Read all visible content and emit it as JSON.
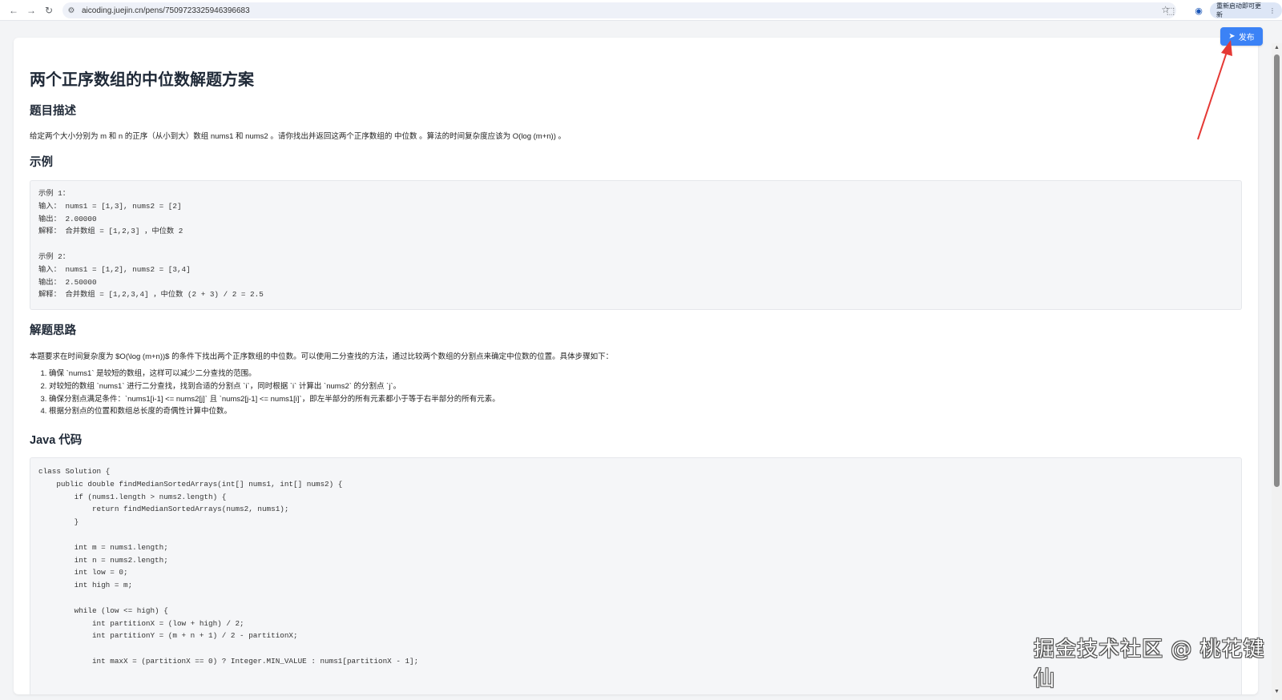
{
  "browser": {
    "url": "aicoding.juejin.cn/pens/7509723325946396683",
    "update_label": "重新启动即可更新",
    "icons": [
      "back-icon",
      "forward-icon",
      "reload-icon",
      "site-info-icon",
      "star-icon",
      "extensions-icon",
      "profile-icon",
      "more-icon"
    ]
  },
  "toolbar": {
    "publish_label": "发布"
  },
  "article": {
    "title": "两个正序数组的中位数解题方案",
    "sections": {
      "description_heading": "题目描述",
      "description_text": "给定两个大小分别为  m  和  n  的正序（从小到大）数组  nums1  和  nums2 。请你找出并返回这两个正序数组的  中位数 。算法的时间复杂度应该为  O(log (m+n)) 。",
      "examples_heading": "示例",
      "examples_code": [
        "示例 1：",
        "输入： nums1 = [1,3], nums2 = [2]",
        "输出： 2.00000",
        "解释： 合并数组 = [1,2,3] ，中位数 2",
        "",
        "示例 2：",
        "输入： nums1 = [1,2], nums2 = [3,4]",
        "输出： 2.50000",
        "解释： 合并数组 = [1,2,3,4] ，中位数 (2 + 3) / 2 = 2.5"
      ],
      "approach_heading": "解题思路",
      "approach_text": "本题要求在时间复杂度为 $O(\\log (m+n))$ 的条件下找出两个正序数组的中位数。可以使用二分查找的方法，通过比较两个数组的分割点来确定中位数的位置。具体步骤如下：",
      "steps": [
        "确保 `nums1` 是较短的数组，这样可以减少二分查找的范围。",
        "对较短的数组 `nums1` 进行二分查找，找到合适的分割点 `i`，同时根据 `i` 计算出 `nums2` 的分割点 `j`。",
        "确保分割点满足条件：`nums1[i-1] <= nums2[j]` 且 `nums2[j-1] <= nums1[i]`，即左半部分的所有元素都小于等于右半部分的所有元素。",
        "根据分割点的位置和数组总长度的奇偶性计算中位数。"
      ],
      "code_heading": "Java 代码",
      "java_code": [
        "class Solution {",
        "    public double findMedianSortedArrays(int[] nums1, int[] nums2) {",
        "        if (nums1.length > nums2.length) {",
        "            return findMedianSortedArrays(nums2, nums1);",
        "        }",
        "",
        "        int m = nums1.length;",
        "        int n = nums2.length;",
        "        int low = 0;",
        "        int high = m;",
        "",
        "        while (low <= high) {",
        "            int partitionX = (low + high) / 2;",
        "            int partitionY = (m + n + 1) / 2 - partitionX;",
        "",
        "            int maxX = (partitionX == 0) ? Integer.MIN_VALUE : nums1[partitionX - 1];"
      ]
    }
  },
  "watermark": "掘金技术社区 @ 桃花键仙",
  "colors": {
    "publish_bg": "#3b82f6",
    "annotation_arrow": "#e53935"
  }
}
